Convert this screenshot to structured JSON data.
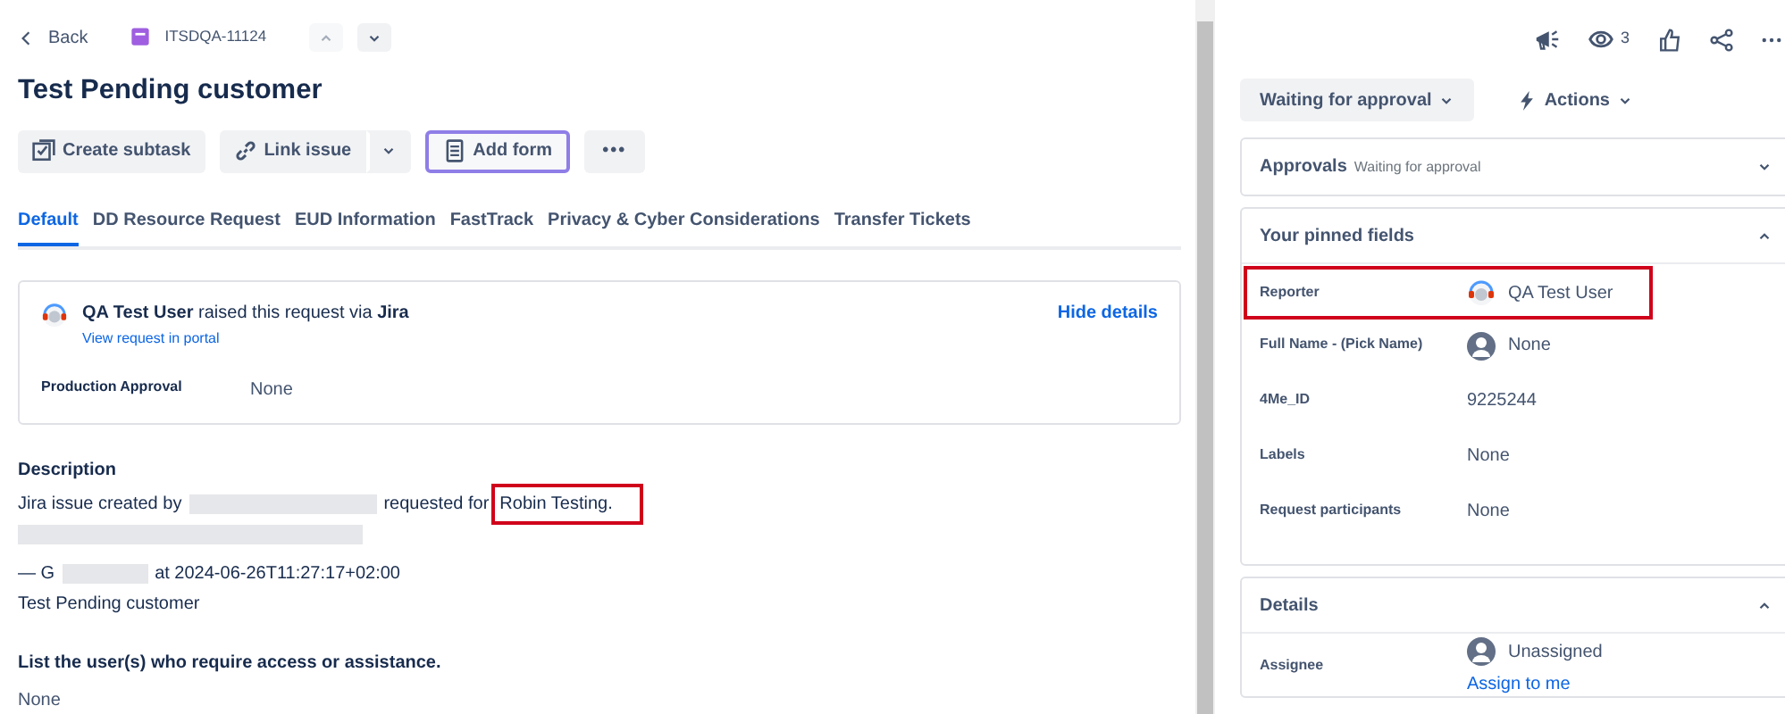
{
  "breadcrumb": {
    "back": "Back",
    "issue_key": "ITSDQA-11124"
  },
  "title": "Test Pending customer",
  "toolbar": [
    {
      "kind": "button",
      "label": "Create subtask",
      "focused": false
    },
    {
      "kind": "split",
      "label": "Link issue",
      "focused": false
    },
    {
      "kind": "button",
      "label": "Add form",
      "focused": true
    },
    {
      "kind": "more",
      "label": "•••",
      "focused": false
    }
  ],
  "tabs": [
    {
      "label": "Default",
      "selected": true
    },
    {
      "label": "DD Resource Request",
      "selected": false
    },
    {
      "label": "EUD Information",
      "selected": false
    },
    {
      "label": "FastTrack",
      "selected": false
    },
    {
      "label": "Privacy & Cyber Considerations",
      "selected": false
    },
    {
      "label": "Transfer Tickets",
      "selected": false
    }
  ],
  "request_card": {
    "raised_line": "**QA Test User** raised this request via **Jira**",
    "portal_link": "View request in portal",
    "hide_link": "Hide details",
    "fields": [
      {
        "label": "Production Approval",
        "value": "None"
      }
    ]
  },
  "description": {
    "heading": "Description",
    "line_1_start": "Jira issue created by",
    "line_1_middle": "requested for",
    "line_1_end": {
      "text": "Robin Testing.",
      "highlighted": true
    },
    "line_2_start": "— G",
    "line_2_end": "at 2024-06-26T11:27:17+02:00",
    "line_3": "Test Pending customer"
  },
  "question": {
    "heading": "List the user(s) who require access or assistance.",
    "answer": "None"
  },
  "header_actions": {
    "watchers": "3"
  },
  "status": {
    "label": "Waiting for approval",
    "actions": "Actions"
  },
  "panels": [
    {
      "title": "Approvals",
      "subtitle": "Waiting for approval",
      "expanded": false
    },
    {
      "title": "Your pinned fields",
      "expanded": true,
      "fields": [
        {
          "kind": "user",
          "label": "Reporter",
          "value": "QA Test User",
          "highlighted": true
        },
        {
          "kind": "empty-avatar",
          "label": "Full Name - (Pick Name)",
          "value": "None",
          "highlighted": false
        },
        {
          "kind": "plain",
          "label": "4Me_ID",
          "value": "9225244",
          "highlighted": false
        },
        {
          "kind": "plain",
          "label": "Labels",
          "value": "None",
          "highlighted": false
        },
        {
          "kind": "plain",
          "label": "Request participants",
          "value": "None",
          "highlighted": false
        }
      ]
    },
    {
      "title": "Details",
      "expanded": true,
      "fields": [
        {
          "kind": "empty-avatar",
          "label": "Assignee",
          "value": "Unassigned",
          "highlighted": false,
          "link": "Assign to me"
        }
      ]
    }
  ]
}
